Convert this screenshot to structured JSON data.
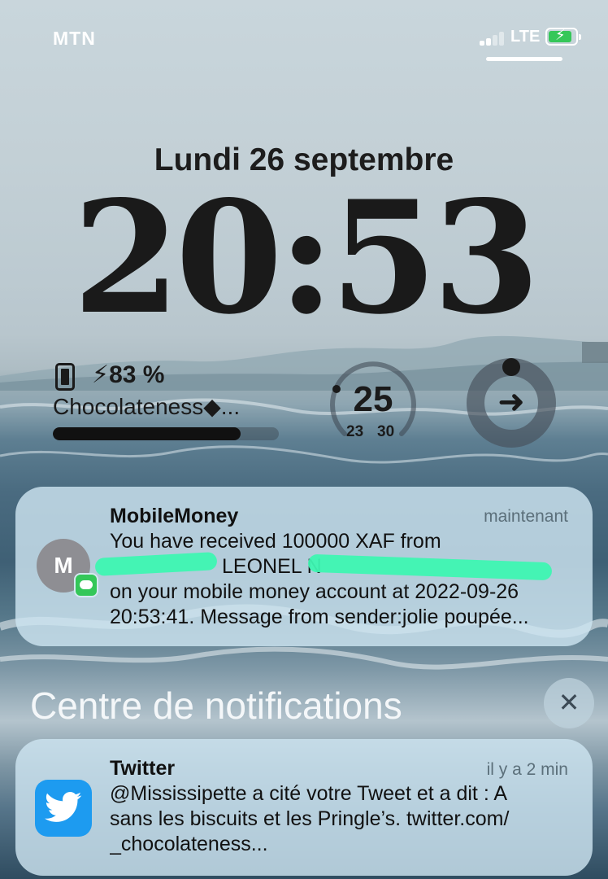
{
  "status_bar": {
    "carrier": "MTN",
    "network": "LTE",
    "battery_charging": true
  },
  "lockscreen": {
    "date": "Lundi 26 septembre",
    "time": "20:53"
  },
  "widgets": {
    "battery": {
      "percent_label": "⚡83 %",
      "percent": 83,
      "device_name": "Chocolateness◆...",
      "icon": "phone-icon"
    },
    "temperature_ring": {
      "value": "25",
      "min": "23",
      "max": "30"
    },
    "activity": {
      "icon": "arrow-right-icon"
    }
  },
  "notifications": [
    {
      "app": "MobileMoney",
      "time": "maintenant",
      "avatar_letter": "M",
      "lines": [
        "You have received 100000 XAF from",
        "LEONEL N",
        "on your mobile money account at 2022-09-26",
        "20:53:41. Message from sender:jolie poupée..."
      ]
    }
  ],
  "notification_center": {
    "title": "Centre de notifications",
    "close_icon": "close-icon"
  },
  "older_notifications": [
    {
      "app": "Twitter",
      "time": "il y a 2 min",
      "lines": [
        "@Mississipette a cité votre Tweet et a dit : A",
        "sans les biscuits et les Pringle’s. twitter.com/",
        "_chocolateness..."
      ]
    }
  ],
  "colors": {
    "accent_green": "#34c759",
    "twitter_blue": "#1d9bf0",
    "redaction_marker": "#3ef5b2"
  }
}
